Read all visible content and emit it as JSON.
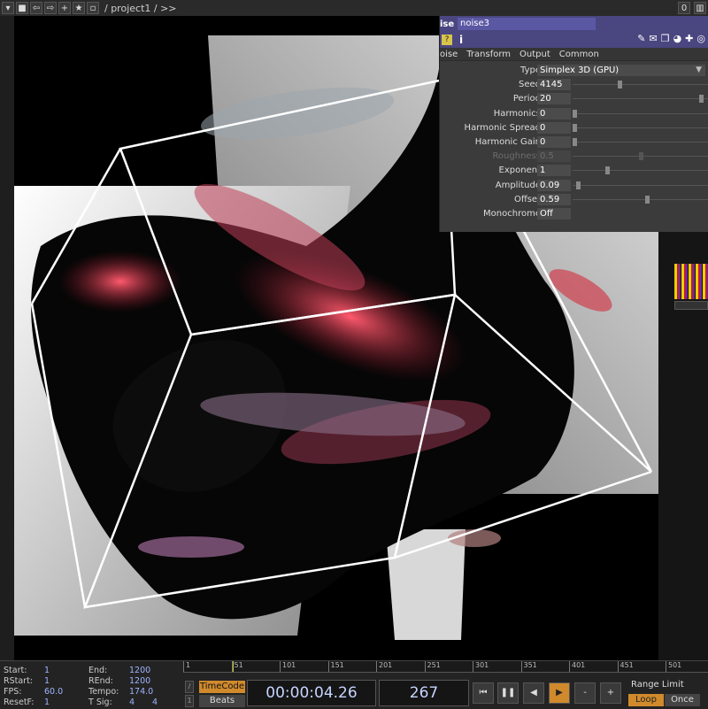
{
  "topbar": {
    "path": "/ project1 / >>",
    "right_value": "0"
  },
  "param_panel": {
    "op_type": "ise",
    "op_name": "noise3",
    "info_glyph": "i",
    "tabs": [
      "oise",
      "Transform",
      "Output",
      "Common"
    ],
    "params": [
      {
        "label": "Type",
        "value": "Simplex 3D (GPU)",
        "kind": "menu"
      },
      {
        "label": "Seed",
        "value": "4145",
        "slider": 0.34
      },
      {
        "label": "Period",
        "value": "20",
        "slider": 0.96
      },
      {
        "label": "Harmonics",
        "value": "0",
        "slider": 0.0
      },
      {
        "label": "Harmonic Spread",
        "value": "0",
        "slider": 0.0
      },
      {
        "label": "Harmonic Gain",
        "value": "0",
        "slider": 0.0
      },
      {
        "label": "Roughness",
        "value": "0.5",
        "slider": 0.5,
        "disabled": true
      },
      {
        "label": "Exponent",
        "value": "1",
        "slider": 0.25
      },
      {
        "label": "Amplitude",
        "value": "0.09",
        "slider": 0.03
      },
      {
        "label": "Offset",
        "value": "0.59",
        "slider": 0.55
      },
      {
        "label": "Monochrome",
        "value": "Off",
        "kind": "toggle"
      }
    ]
  },
  "time_info": {
    "start_label": "Start:",
    "start": "1",
    "end_label": "End:",
    "end": "1200",
    "rstart_label": "RStart:",
    "rstart": "1",
    "rend_label": "REnd:",
    "rend": "1200",
    "fps_label": "FPS:",
    "fps": "60.0",
    "tempo_label": "Tempo:",
    "tempo": "174.0",
    "resetf_label": "ResetF:",
    "resetf": "1",
    "tsig_label": "T Sig:",
    "tsig_num": "4",
    "tsig_den": "4"
  },
  "timeline": {
    "ticks": [
      "1",
      "51",
      "101",
      "151",
      "201",
      "251",
      "301",
      "351",
      "401",
      "451",
      "501"
    ],
    "timecode_label": "TimeCode",
    "beats_label": "Beats",
    "timecode": "00:00:04.26",
    "frame": "267",
    "range_limit_label": "Range Limit",
    "loop_label": "Loop",
    "once_label": "Once"
  },
  "colors": {
    "panel_header": "#4a4680",
    "accent_orange": "#d08a2c",
    "value_blue": "#9fb4ff"
  },
  "icons": [
    "home-icon",
    "back-icon",
    "forward-icon",
    "add-icon",
    "bookmark-icon",
    "wrench-icon",
    "comment-icon",
    "copy-icon",
    "python-icon",
    "plus-icon",
    "target-icon"
  ]
}
